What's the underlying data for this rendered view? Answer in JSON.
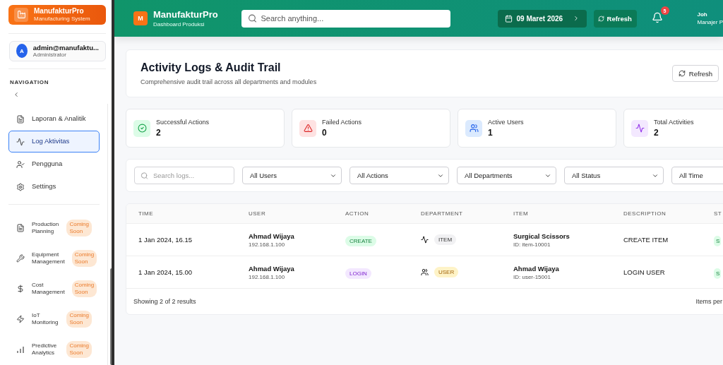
{
  "sidebar": {
    "brand": {
      "title": "ManufakturPro",
      "subtitle": "Manufacturing System"
    },
    "user": {
      "initial": "A",
      "email": "admin@manufaktu...",
      "role": "Administrator"
    },
    "section_title": "NAVIGATION",
    "items": [
      {
        "label": "Laporan & Analitik",
        "kind": "link",
        "selected": false
      },
      {
        "label": "Log Aktivitas",
        "kind": "link",
        "selected": true
      },
      {
        "label": "Pengguna",
        "kind": "link",
        "selected": false
      },
      {
        "label": "Settings",
        "kind": "link",
        "selected": false
      },
      {
        "label": "Production Planning",
        "kind": "coming_soon",
        "selected": false,
        "badge": "Coming Soon"
      },
      {
        "label": "Equipment Management",
        "kind": "coming_soon",
        "selected": false,
        "badge": "Coming Soon"
      },
      {
        "label": "Cost Management",
        "kind": "coming_soon",
        "selected": false,
        "badge": "Coming Soon"
      },
      {
        "label": "IoT Monitoring",
        "kind": "coming_soon",
        "selected": false,
        "badge": "Coming Soon"
      },
      {
        "label": "Predictive Analytics",
        "kind": "coming_soon",
        "selected": false,
        "badge": "Coming Soon"
      }
    ]
  },
  "header": {
    "logo": "M",
    "title": "ManufakturPro",
    "subtitle": "Dashboard Produksi",
    "search": {
      "placeholder": "Search anything..."
    },
    "date": "09 Maret 2026",
    "refresh": "Refresh",
    "notifications": "5",
    "user_name": "Joh",
    "user_role": "Manajer P"
  },
  "page": {
    "title": "Activity Logs & Audit Trail",
    "subtitle": "Comprehensive audit trail across all departments and modules",
    "refresh": "Refresh"
  },
  "stats": [
    {
      "kind": "success",
      "label": "Successful Actions",
      "value": "2"
    },
    {
      "kind": "failed",
      "label": "Failed Actions",
      "value": "0"
    },
    {
      "kind": "users",
      "label": "Active Users",
      "value": "1"
    },
    {
      "kind": "total",
      "label": "Total Activities",
      "value": "2"
    }
  ],
  "filters": {
    "search": {
      "placeholder": "Search logs..."
    },
    "selects": [
      "All Users",
      "All Actions",
      "All Departments",
      "All Status",
      "All Time"
    ]
  },
  "table": {
    "columns": [
      "TIME",
      "USER",
      "ACTION",
      "DEPARTMENT",
      "ITEM",
      "DESCRIPTION",
      "ST"
    ],
    "rows": [
      {
        "time": "1 Jan 2024, 16.15",
        "user": "Ahmad Wijaya",
        "ip": "192.168.1.100",
        "action": {
          "label": "CREATE",
          "kind": "create"
        },
        "department": {
          "label": "ITEM",
          "kind": "item"
        },
        "item": "Surgical Scissors",
        "item_id": "ID: item-10001",
        "description": "CREATE ITEM",
        "status": "S"
      },
      {
        "time": "1 Jan 2024, 15.00",
        "user": "Ahmad Wijaya",
        "ip": "192.168.1.100",
        "action": {
          "label": "LOGIN",
          "kind": "login"
        },
        "department": {
          "label": "USER",
          "kind": "user"
        },
        "item": "Ahmad Wijaya",
        "item_id": "ID: user-15001",
        "description": "LOGIN USER",
        "status": "S"
      }
    ],
    "footer": "Showing 2 of 2 results",
    "items_per_page": "Items per"
  }
}
